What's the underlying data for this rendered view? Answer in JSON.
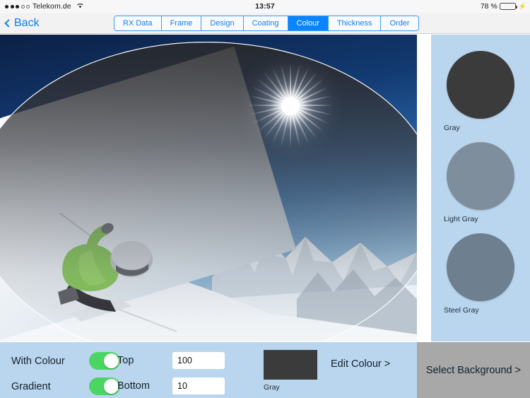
{
  "statusbar": {
    "carrier": "Telekom.de",
    "signal_filled": 3,
    "signal_hollow": 2,
    "wifi_icon": "wifi-icon",
    "time": "13:57",
    "battery_percent": "78 %",
    "battery_level": 78,
    "charging_icon": "bolt-icon"
  },
  "navbar": {
    "back_label": "Back",
    "back_icon": "chevron-left-icon",
    "segments": [
      {
        "label": "RX Data",
        "active": false
      },
      {
        "label": "Frame",
        "active": false
      },
      {
        "label": "Design",
        "active": false
      },
      {
        "label": "Coating",
        "active": false
      },
      {
        "label": "Colour",
        "active": true
      },
      {
        "label": "Thickness",
        "active": false
      },
      {
        "label": "Order",
        "active": false
      }
    ]
  },
  "preview": {
    "scene": "skier-on-snow-slope-with-sun",
    "lens_overlay": "tinted-lens-ellipse"
  },
  "swatch_panel": {
    "background_color": "#b9d6ee",
    "items": [
      {
        "label": "Gray",
        "color": "#3b3b3b"
      },
      {
        "label": "Light Gray",
        "color": "#7e8e9c"
      },
      {
        "label": "Steel Gray",
        "color": "#6e7f8f"
      }
    ]
  },
  "bottombar": {
    "with_colour_label": "With Colour",
    "with_colour_on": true,
    "gradient_label": "Gradient",
    "gradient_on": true,
    "top_label": "Top",
    "top_value": "100",
    "top_placeholder": "100",
    "bottom_label": "Bottom",
    "bottom_value": "10",
    "bottom_placeholder": "10",
    "preview_colour": "#3b3b3b",
    "preview_colour_label": "Gray",
    "edit_colour_label": "Edit Colour >",
    "toggle_on_color": "#4bd664"
  },
  "select_background": {
    "label": "Select Background >",
    "background_color": "#a8a8a8"
  }
}
